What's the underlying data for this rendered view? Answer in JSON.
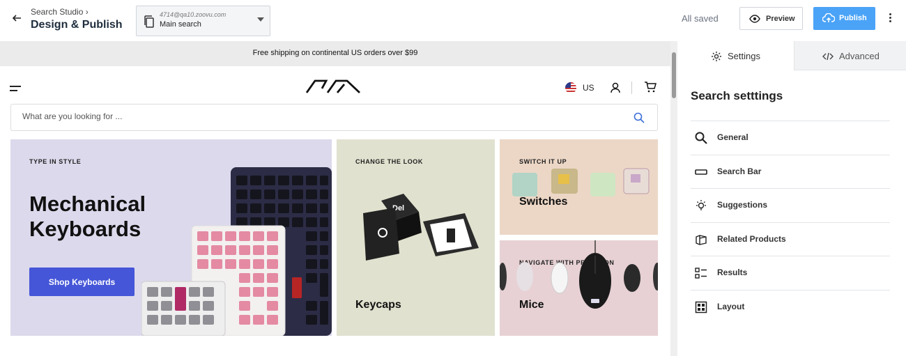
{
  "header": {
    "breadcrumb": "Search Studio",
    "title": "Design & Publish",
    "selector": {
      "account": "4714@qa10.zoovu.com",
      "value": "Main search"
    },
    "status": "All saved",
    "preview_label": "Preview",
    "publish_label": "Publish"
  },
  "store": {
    "shipping_banner": "Free shipping on continental US orders over $99",
    "region": "US",
    "search_placeholder": "What are you looking for ...",
    "tiles": [
      {
        "eyebrow": "TYPE IN STYLE",
        "title": "Mechanical Keyboards",
        "button": "Shop Keyboards"
      },
      {
        "eyebrow": "CHANGE THE LOOK",
        "title": "Keycaps"
      },
      {
        "eyebrow": "SWITCH IT UP",
        "title": "Switches"
      },
      {
        "eyebrow": "NAVIGATE WITH PRECISION",
        "title": "Mice"
      }
    ],
    "keycap_text": "Del"
  },
  "panel": {
    "tabs": [
      {
        "label": "Settings",
        "icon": "gear-icon"
      },
      {
        "label": "Advanced",
        "icon": "code-icon"
      }
    ],
    "heading": "Search setttings",
    "items": [
      {
        "label": "General",
        "icon": "search-icon"
      },
      {
        "label": "Search Bar",
        "icon": "search-bar-icon"
      },
      {
        "label": "Suggestions",
        "icon": "lightbulb-icon"
      },
      {
        "label": "Related Products",
        "icon": "box-icon"
      },
      {
        "label": "Results",
        "icon": "list-icon"
      },
      {
        "label": "Layout",
        "icon": "grid-icon"
      }
    ]
  },
  "colors": {
    "publish": "#4aa3f7",
    "shop_button": "#4556d8"
  }
}
